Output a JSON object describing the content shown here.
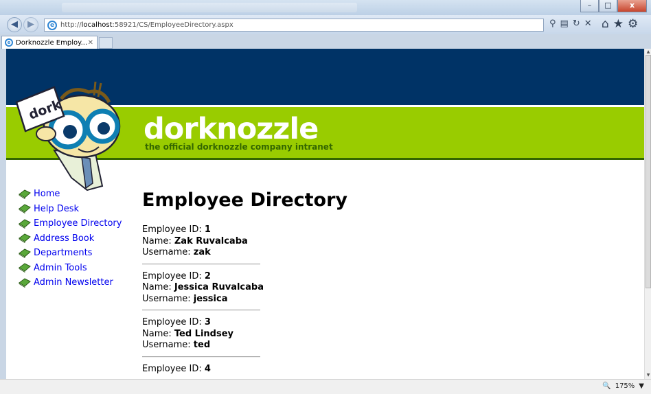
{
  "browser": {
    "url_prefix": "http://",
    "url_host": "localhost",
    "url_rest": ":58921/CS/EmployeeDirectory.aspx",
    "tab_title": "Dorknozzle Employ...",
    "zoom": "175%",
    "window_buttons": {
      "minimize": "–",
      "maximize": "□",
      "close": "x"
    }
  },
  "header": {
    "brand": "dorknozzle",
    "tagline": "the official dorknozzle company intranet",
    "mascot_sign": "dork"
  },
  "menu": [
    {
      "label": "Home"
    },
    {
      "label": "Help Desk"
    },
    {
      "label": "Employee Directory"
    },
    {
      "label": "Address Book"
    },
    {
      "label": "Departments"
    },
    {
      "label": "Admin Tools"
    },
    {
      "label": "Admin Newsletter"
    }
  ],
  "page": {
    "title": "Employee Directory",
    "id_label": "Employee ID: ",
    "name_label": "Name: ",
    "username_label": "Username: ",
    "employees": [
      {
        "id": "1",
        "name": "Zak Ruvalcaba",
        "username": "zak"
      },
      {
        "id": "2",
        "name": "Jessica Ruvalcaba",
        "username": "jessica"
      },
      {
        "id": "3",
        "name": "Ted Lindsey",
        "username": "ted"
      },
      {
        "id": "4",
        "name": "",
        "username": ""
      }
    ]
  },
  "colors": {
    "header_blue": "#003366",
    "header_green": "#99cc00",
    "tagline": "#336600",
    "link": "#0000ee"
  }
}
